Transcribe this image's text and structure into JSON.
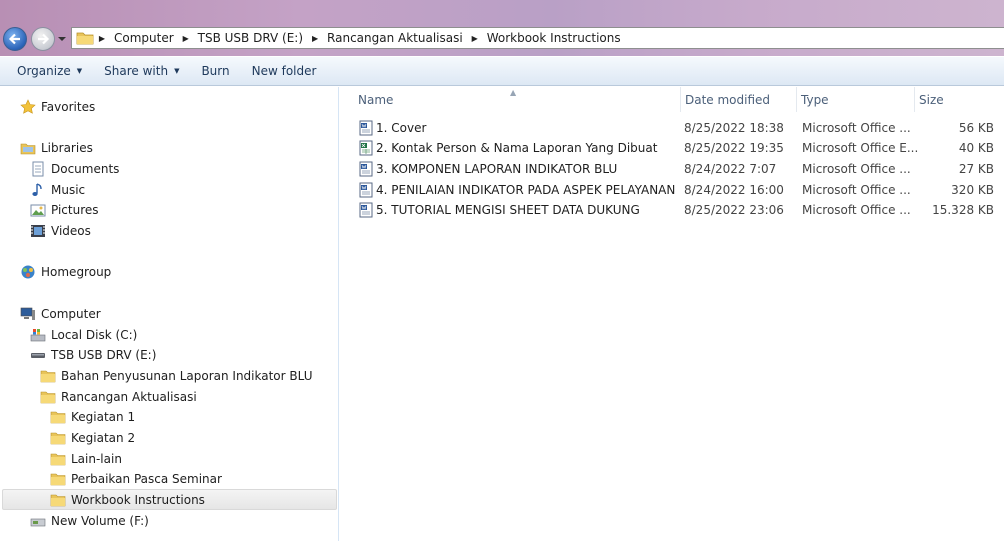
{
  "address": {
    "crumbs": [
      "Computer",
      "TSB USB DRV (E:)",
      "Rancangan Aktualisasi",
      "Workbook Instructions"
    ]
  },
  "toolbar": {
    "organize": "Organize",
    "share_with": "Share with",
    "burn": "Burn",
    "new_folder": "New folder"
  },
  "nav": {
    "favorites": "Favorites",
    "libraries": "Libraries",
    "documents": "Documents",
    "music": "Music",
    "pictures": "Pictures",
    "videos": "Videos",
    "homegroup": "Homegroup",
    "computer": "Computer",
    "local_disk": "Local Disk (C:)",
    "usb": "TSB USB DRV (E:)",
    "bahan": "Bahan Penyusunan Laporan Indikator BLU",
    "rancangan": "Rancangan Aktualisasi",
    "kegiatan1": "Kegiatan 1",
    "kegiatan2": "Kegiatan 2",
    "lain": "Lain-lain",
    "perbaikan": "Perbaikan Pasca Seminar",
    "workbook": "Workbook Instructions",
    "new_volume": "New Volume (F:)"
  },
  "columns": {
    "name": "Name",
    "date": "Date modified",
    "type": "Type",
    "size": "Size"
  },
  "files": [
    {
      "name": "1. Cover",
      "date": "8/25/2022 18:38",
      "type": "Microsoft Office ...",
      "size": "56 KB",
      "icon": "word-doc-icon"
    },
    {
      "name": "2. Kontak Person & Nama Laporan Yang Dibuat",
      "date": "8/25/2022 19:35",
      "type": "Microsoft Office E...",
      "size": "40 KB",
      "icon": "excel-doc-icon"
    },
    {
      "name": "3. KOMPONEN LAPORAN INDIKATOR BLU",
      "date": "8/24/2022 7:07",
      "type": "Microsoft Office ...",
      "size": "27 KB",
      "icon": "word-doc-icon"
    },
    {
      "name": "4. PENILAIAN INDIKATOR PADA ASPEK PELAYANAN",
      "date": "8/24/2022 16:00",
      "type": "Microsoft Office ...",
      "size": "320 KB",
      "icon": "word-doc-icon"
    },
    {
      "name": "5. TUTORIAL MENGISI SHEET DATA DUKUNG",
      "date": "8/25/2022 23:06",
      "type": "Microsoft Office ...",
      "size": "15.328 KB",
      "icon": "word-doc-icon"
    }
  ],
  "colors": {
    "toolbar_text": "#1e395b",
    "header_text": "#4c607a",
    "folder": "#e8c45a"
  }
}
